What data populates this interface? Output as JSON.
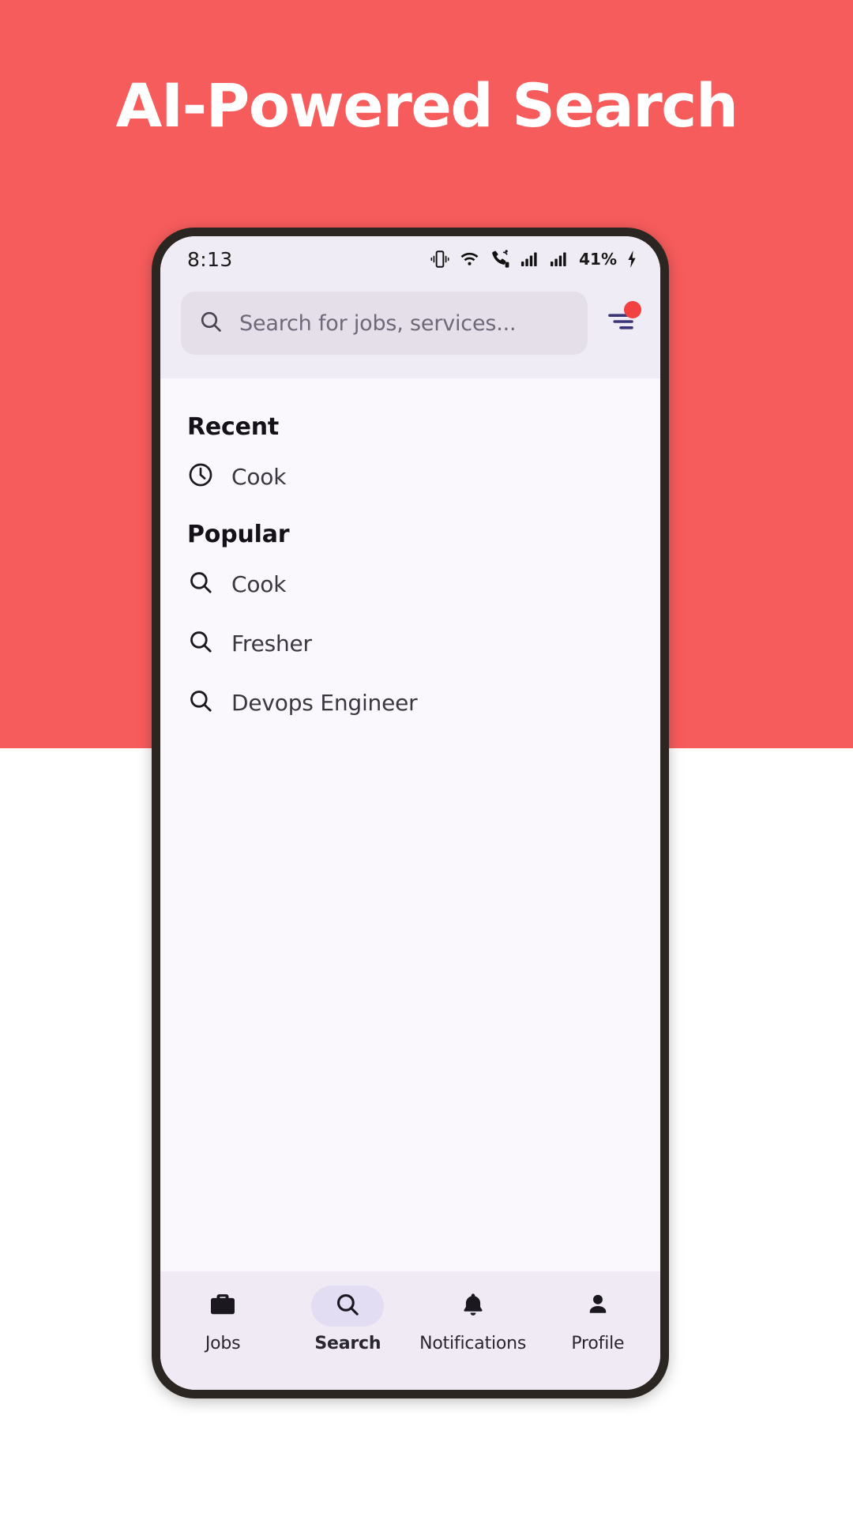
{
  "hero": {
    "title": "AI-Powered Search",
    "background_color": "#F75C5C",
    "title_color": "#FFFFFF"
  },
  "status_bar": {
    "time": "8:13",
    "battery_text": "41%",
    "icons": [
      "vibrate-icon",
      "wifi-icon",
      "call-signal-icon",
      "signal-bars-icon",
      "signal-bars-icon",
      "charging-bolt-icon"
    ]
  },
  "search": {
    "placeholder": "Search for jobs, services...",
    "value": "",
    "search_icon": "search-icon",
    "filter_icon": "filter-icon",
    "filter_badge_color": "#F24141"
  },
  "sections": [
    {
      "title": "Recent",
      "icon": "clock-icon",
      "items": [
        {
          "label": "Cook"
        }
      ]
    },
    {
      "title": "Popular",
      "icon": "search-icon",
      "items": [
        {
          "label": "Cook"
        },
        {
          "label": "Fresher"
        },
        {
          "label": "Devops Engineer"
        }
      ]
    }
  ],
  "bottom_nav": {
    "active_index": 1,
    "items": [
      {
        "label": "Jobs",
        "icon": "briefcase-icon"
      },
      {
        "label": "Search",
        "icon": "search-icon"
      },
      {
        "label": "Notifications",
        "icon": "bell-icon"
      },
      {
        "label": "Profile",
        "icon": "person-icon"
      }
    ]
  }
}
